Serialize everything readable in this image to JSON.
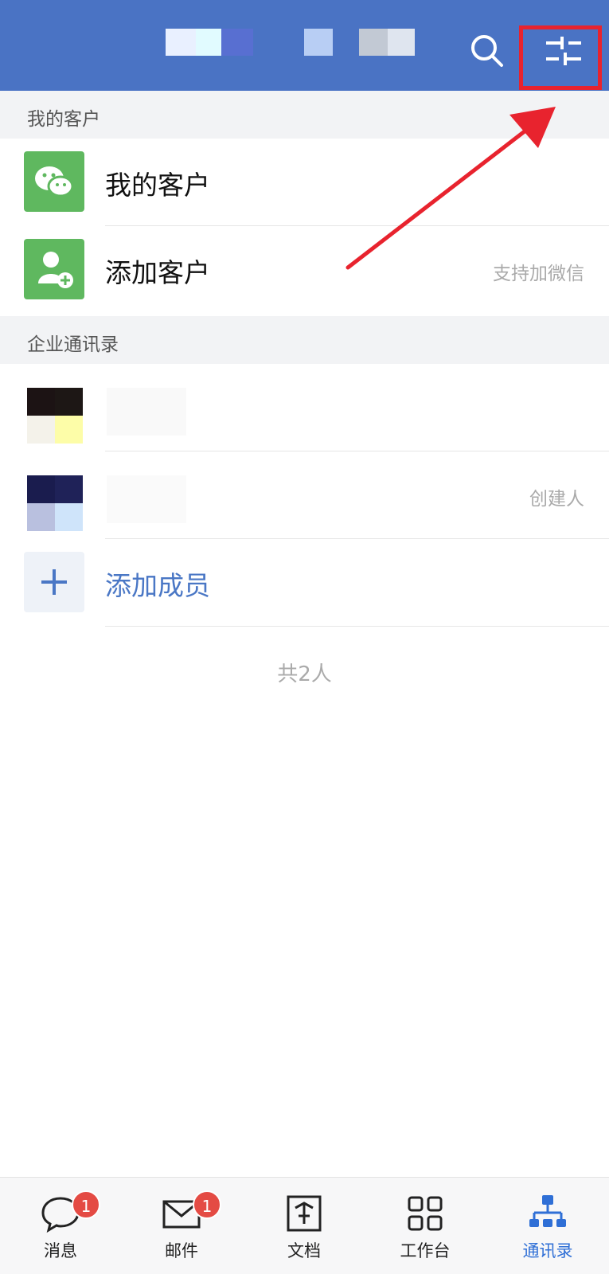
{
  "header": {
    "search_icon": "search-icon",
    "filter_icon": "sliders-icon",
    "highlight_color": "#e8232e",
    "bar_color": "#4a73c4"
  },
  "customers_section": {
    "title": "我的客户",
    "items": [
      {
        "label": "我的客户",
        "icon": "wechat-icon",
        "note": ""
      },
      {
        "label": "添加客户",
        "icon": "add-user-icon",
        "note": "支持加微信"
      }
    ]
  },
  "contacts_section": {
    "title": "企业通讯录",
    "members": [
      {
        "note": ""
      },
      {
        "note": "创建人"
      }
    ],
    "add_member_label": "添加成员",
    "total_label": "共2人"
  },
  "tabbar": {
    "tabs": [
      {
        "label": "消息",
        "icon": "chat-icon",
        "badge": "1"
      },
      {
        "label": "邮件",
        "icon": "mail-icon",
        "badge": "1"
      },
      {
        "label": "文档",
        "icon": "document-icon",
        "badge": ""
      },
      {
        "label": "工作台",
        "icon": "grid-icon",
        "badge": ""
      },
      {
        "label": "通讯录",
        "icon": "org-chart-icon",
        "badge": "",
        "active": true
      }
    ]
  },
  "accent_color": "#2f6fd6",
  "add_color": "#4a77c5"
}
